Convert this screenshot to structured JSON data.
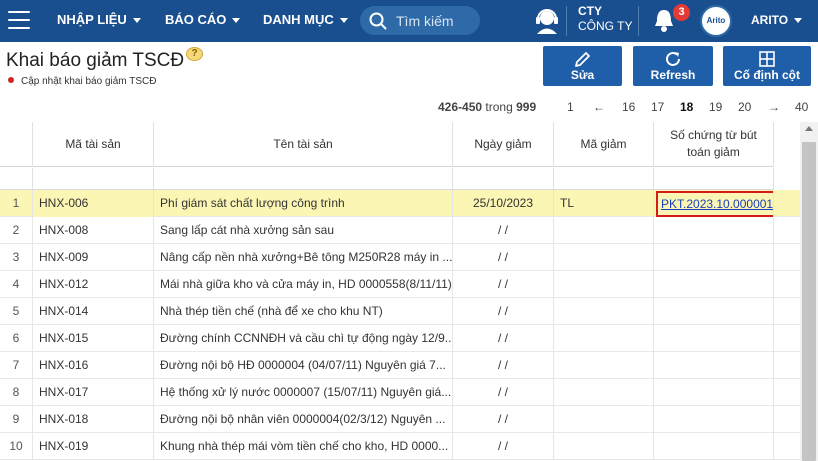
{
  "nav": {
    "menus": [
      {
        "label": "NHẬP LIỆU"
      },
      {
        "label": "BÁO CÁO"
      },
      {
        "label": "DANH MỤC"
      }
    ],
    "search_placeholder": "Tìm kiếm",
    "company_line1": "CTY",
    "company_line2": "CÔNG TY",
    "notification_count": "3",
    "logo_text": "Arito",
    "user": "ARITO"
  },
  "page": {
    "title": "Khai báo giảm TSCĐ",
    "help": "?",
    "subtitle": "Cập nhật khai báo giảm TSCĐ"
  },
  "toolbar": {
    "edit_label": "Sửa",
    "refresh_label": "Refresh",
    "freeze_label": "Cố định cột"
  },
  "pager": {
    "range": "426-450",
    "of_label": "trong",
    "total": "999",
    "pages": [
      "1",
      "←",
      "16",
      "17",
      "18",
      "19",
      "20",
      "→",
      "40"
    ],
    "current": "18"
  },
  "table": {
    "columns": [
      "Mã tài sản",
      "Tên tài sản",
      "Ngày giảm",
      "Mã giảm",
      "Số chứng từ bút toán giảm"
    ],
    "rows": [
      {
        "n": "1",
        "code": "HNX-006",
        "name": "Phí giám sát chất lượng công trình",
        "date": "25/10/2023",
        "reason": "TL",
        "voucher": "PKT.2023.10.000001"
      },
      {
        "n": "2",
        "code": "HNX-008",
        "name": "Sang lấp cát nhà xưởng sản sau",
        "date": "/ /",
        "reason": "",
        "voucher": ""
      },
      {
        "n": "3",
        "code": "HNX-009",
        "name": "Nâng cấp nền nhà xưởng+Bê tông M250R28 máy in ...",
        "date": "/ /",
        "reason": "",
        "voucher": ""
      },
      {
        "n": "4",
        "code": "HNX-012",
        "name": "Mái nhà giữa kho và cửa máy in, HD 0000558(8/11/11)",
        "date": "/ /",
        "reason": "",
        "voucher": ""
      },
      {
        "n": "5",
        "code": "HNX-014",
        "name": "Nhà thép tiền chế (nhà để xe cho khu NT)",
        "date": "/ /",
        "reason": "",
        "voucher": ""
      },
      {
        "n": "6",
        "code": "HNX-015",
        "name": "Đường chính CCNNĐH và cầu chì tự động ngày 12/9...",
        "date": "/ /",
        "reason": "",
        "voucher": ""
      },
      {
        "n": "7",
        "code": "HNX-016",
        "name": "Đường nội bộ HĐ 0000004 (04/07/11) Nguyên giá 7...",
        "date": "/ /",
        "reason": "",
        "voucher": ""
      },
      {
        "n": "8",
        "code": "HNX-017",
        "name": "Hệ thống xử lý nước 0000007 (15/07/11) Nguyên giá...",
        "date": "/ /",
        "reason": "",
        "voucher": ""
      },
      {
        "n": "9",
        "code": "HNX-018",
        "name": "Đường nội bộ nhân viên 0000004(02/3/12) Nguyên ...",
        "date": "/ /",
        "reason": "",
        "voucher": ""
      },
      {
        "n": "10",
        "code": "HNX-019",
        "name": "Khung nhà thép mái vòm tiền chế cho kho, HD 0000...",
        "date": "/ /",
        "reason": "",
        "voucher": ""
      }
    ]
  },
  "colors": {
    "navbar": "#1a4f8f",
    "button": "#1f5ea8",
    "selected_row": "#fbf6b4",
    "highlight_border": "#d51a1a",
    "badge": "#e53935"
  },
  "icons": {
    "menu": "hamburger-icon",
    "search": "search-icon",
    "support": "headset-icon",
    "notifications": "bell-icon",
    "edit": "pencil-icon",
    "refresh": "refresh-icon",
    "freeze": "freeze-columns-icon"
  }
}
